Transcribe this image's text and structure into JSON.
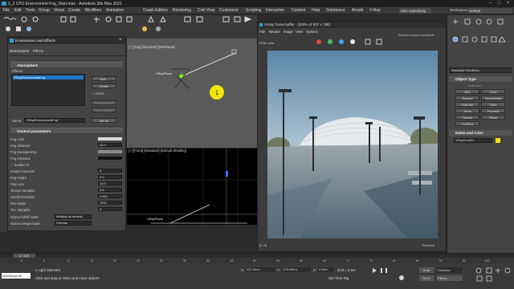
{
  "window": {
    "title": "2_2 CPU Environment Fog_Start.max - Autodesk 3ds Max 2021"
  },
  "menubar": {
    "items": [
      "File",
      "Edit",
      "Tools",
      "Group",
      "Views",
      "Create",
      "Modifiers",
      "Animation",
      "Graph Editors",
      "Rendering",
      "Civil View",
      "Customize",
      "Scripting",
      "Interactive",
      "Content",
      "Help",
      "Substance",
      "Arnold",
      "V-Ray"
    ],
    "signin": "tako subenburg",
    "workspaces_label": "Workspaces:",
    "workspaces_value": "Default"
  },
  "env_dialog": {
    "title": "Environment and Effects",
    "tabs": [
      "Environment",
      "Effects"
    ],
    "atmosphere_header": "Atmosphere",
    "effects_label": "Effects:",
    "effects_list": [
      "VRayEnvironmentFog"
    ],
    "add": "Add...",
    "delete": "Delete",
    "active": "Active",
    "move_up": "Move Up",
    "move_down": "Move Down",
    "name_label": "Name:",
    "name_value": "VRayEnvironmentFog",
    "merge": "Merge",
    "general_header": "General parameters",
    "params": [
      {
        "label": "Fog color",
        "value": ""
      },
      {
        "label": "Fog distance",
        "value": "10.0"
      },
      {
        "label": "Fog transparency",
        "value": ""
      },
      {
        "label": "Fog emission",
        "value": ""
      },
      {
        "label": "Scatter GI",
        "value": ""
      },
      {
        "label": "Scatter bounces",
        "value": "8"
      },
      {
        "label": "Fog height",
        "value": "0.0"
      },
      {
        "label": "Step size",
        "value": "10.0"
      },
      {
        "label": "Texture samples",
        "value": "0.5"
      },
      {
        "label": "Cutoff threshold",
        "value": "0.001"
      },
      {
        "label": "Max steps",
        "value": "1000"
      },
      {
        "label": "Tex. samples",
        "value": "4"
      }
    ],
    "gizmo_falloff_label": "Gizmo falloff mode",
    "gizmo_falloff_value": "Multiply by density",
    "gizmo_merge_label": "Gizmo merge mode",
    "gizmo_merge_value": "Overlap"
  },
  "viewports": {
    "top_label": "[+] [Top] [Standard] [Wireframe]",
    "top_object": "VRayPlane",
    "front_label": "[+] [Front] [Standard] [Default Shading]",
    "front_object": "VRayPlane"
  },
  "framebuffer": {
    "title": "V-Ray frame buffer - [100% of 837 x 768]",
    "menus": [
      "File",
      "Render",
      "Image",
      "View",
      "Options"
    ],
    "channel": "RGB color",
    "status": "Render session available",
    "footer_coords": "[0, 0]",
    "footer_mode": "Finished"
  },
  "command_panel": {
    "object_category": "Standard Primitives",
    "object_type_header": "Object Type",
    "autogrid": "AutoGrid",
    "buttons": [
      "Box",
      "Cone",
      "Sphere",
      "GeoSphere",
      "Cylinder",
      "Tube",
      "Torus",
      "Pyramid",
      "Teapot",
      "Plane",
      "TextPlus"
    ],
    "name_color_header": "Name and Color",
    "name_value": "VRaySun001"
  },
  "timeline": {
    "frame": "0 / 100",
    "ticks": [
      "0",
      "5",
      "10",
      "15",
      "20",
      "25",
      "30",
      "35",
      "40",
      "45",
      "50",
      "55",
      "60",
      "65",
      "70",
      "75",
      "80",
      "85",
      "90",
      "95",
      "100"
    ]
  },
  "status": {
    "maxscript": "MAXScript Mi",
    "selected": "1 Light Selected",
    "hint": "Click and drag to select and move objects",
    "x_label": "X:",
    "x_value": "422.3mm",
    "y_label": "Y:",
    "y_value": "173.006m",
    "z_label": "Z:",
    "z_value": "0.0cm",
    "grid": "Grid = 0.1m",
    "add_time_tag": "Add Time Tag",
    "autokey": "Auto",
    "selected_label": "Selected",
    "setkey": "Set K",
    "filters": "Filters..."
  },
  "colors": {
    "accent_blue": "#1f78c8",
    "highlight_yellow": "#f3e600",
    "fb_close_red": "#e14a4a"
  }
}
